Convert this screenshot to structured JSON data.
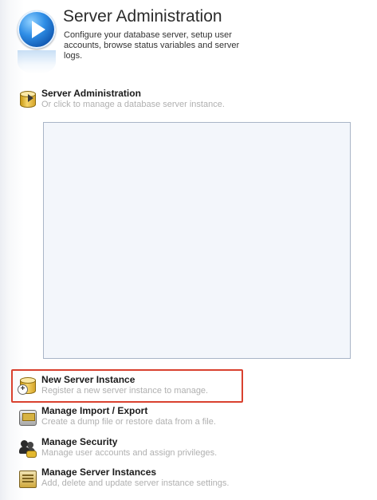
{
  "header": {
    "title": "Server Administration",
    "description": "Configure your database server, setup user accounts, browse status variables and server logs.",
    "icon": "play-icon"
  },
  "section": {
    "title": "Server Administration",
    "subtitle": "Or click to manage a database server instance.",
    "icon": "database-icon"
  },
  "instance_list": {
    "items": []
  },
  "tasks": [
    {
      "title": "New Server Instance",
      "subtitle": "Register a new server instance to manage.",
      "icon": "new-instance-icon",
      "highlighted": true
    },
    {
      "title": "Manage Import / Export",
      "subtitle": "Create a dump file or restore data from a file.",
      "icon": "import-export-icon"
    },
    {
      "title": "Manage Security",
      "subtitle": "Manage user accounts and assign privileges.",
      "icon": "security-icon"
    },
    {
      "title": "Manage Server Instances",
      "subtitle": "Add, delete and update server instance settings.",
      "icon": "server-instances-icon"
    }
  ],
  "colors": {
    "highlight": "#d9412f",
    "accent": "#2f8ee6",
    "muted_text": "#b0b0b0"
  }
}
